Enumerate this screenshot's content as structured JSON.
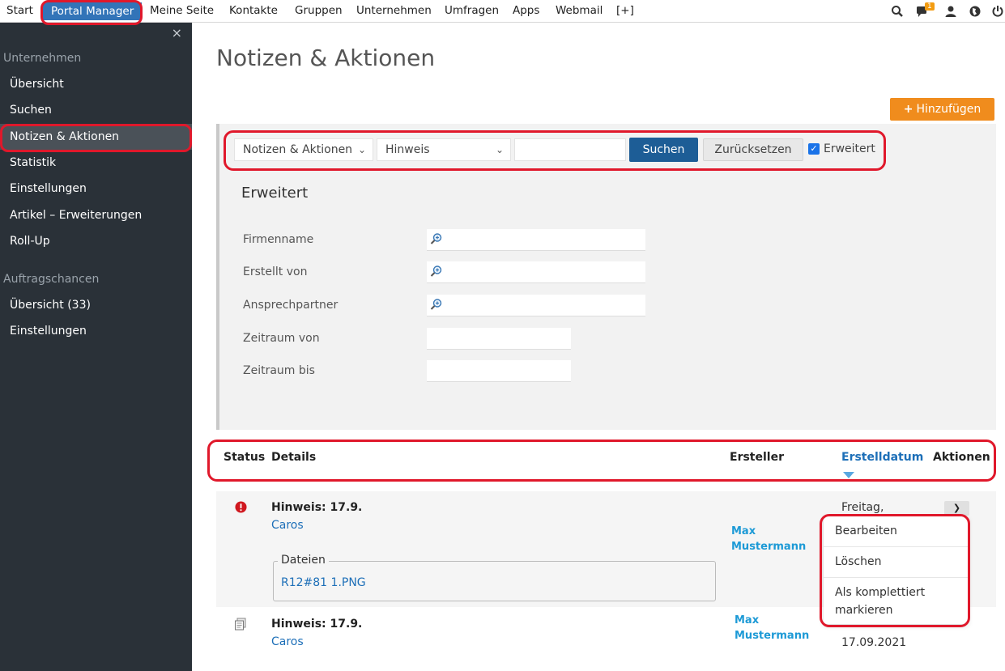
{
  "topnav": {
    "items": [
      "Start",
      "Portal Manager",
      "Meine Seite",
      "Kontakte",
      "Gruppen",
      "Unternehmen",
      "Umfragen",
      "Apps",
      "Webmail",
      "[+]"
    ],
    "notification_count": "1",
    "icons": [
      "search-icon",
      "chat-icon",
      "user-icon",
      "globe-icon",
      "power-icon"
    ]
  },
  "sidebar": {
    "close": "×",
    "section1": "Unternehmen",
    "section1_items": [
      "Übersicht",
      "Suchen",
      "Notizen & Aktionen",
      "Statistik",
      "Einstellungen",
      "Artikel – Erweiterungen",
      "Roll-Up"
    ],
    "section2": "Auftragschancen",
    "section2_items": [
      "Übersicht (33)",
      "Einstellungen"
    ]
  },
  "page": {
    "title": "Notizen & Aktionen",
    "add_label": "Hinzufügen"
  },
  "filter": {
    "type_select": "Notizen & Aktionen",
    "kind_select": "Hinweis",
    "search_value": "",
    "search_label": "Suchen",
    "reset_label": "Zurücksetzen",
    "advanced_checked": true,
    "advanced_label": "Erweitert"
  },
  "advanced": {
    "title": "Erweitert",
    "fields": [
      "Firmenname",
      "Erstellt von",
      "Ansprechpartner",
      "Zeitraum von",
      "Zeitraum bis"
    ]
  },
  "table": {
    "headers": [
      "Status",
      "Details",
      "Ersteller",
      "Erstelldatum",
      "Aktionen"
    ],
    "rows": [
      {
        "status_icon": "alert-icon",
        "title": "Hinweis: 17.9.",
        "company": "Caros",
        "files_legend": "Dateien",
        "file": "R12#81 1.PNG",
        "creator_first": "Max",
        "creator_last": "Mustermann",
        "date_line1": "Freitag,"
      },
      {
        "status_icon": "note-icon",
        "title": "Hinweis: 17.9.",
        "company": "Caros",
        "creator_first": "Max",
        "creator_last": "Mustermann",
        "date_line2": "17.09.2021"
      }
    ]
  },
  "dropdown": {
    "edit": "Bearbeiten",
    "delete": "Löschen",
    "complete_line1": "Als komplettiert",
    "complete_line2": "markieren"
  },
  "colors": {
    "annotation_red": "#e0182b",
    "nav_active": "#3274b8",
    "sidebar_bg": "#2a3138",
    "add_button": "#f08c1d",
    "search_button": "#1d5d96",
    "link_blue": "#1d6fb8"
  }
}
